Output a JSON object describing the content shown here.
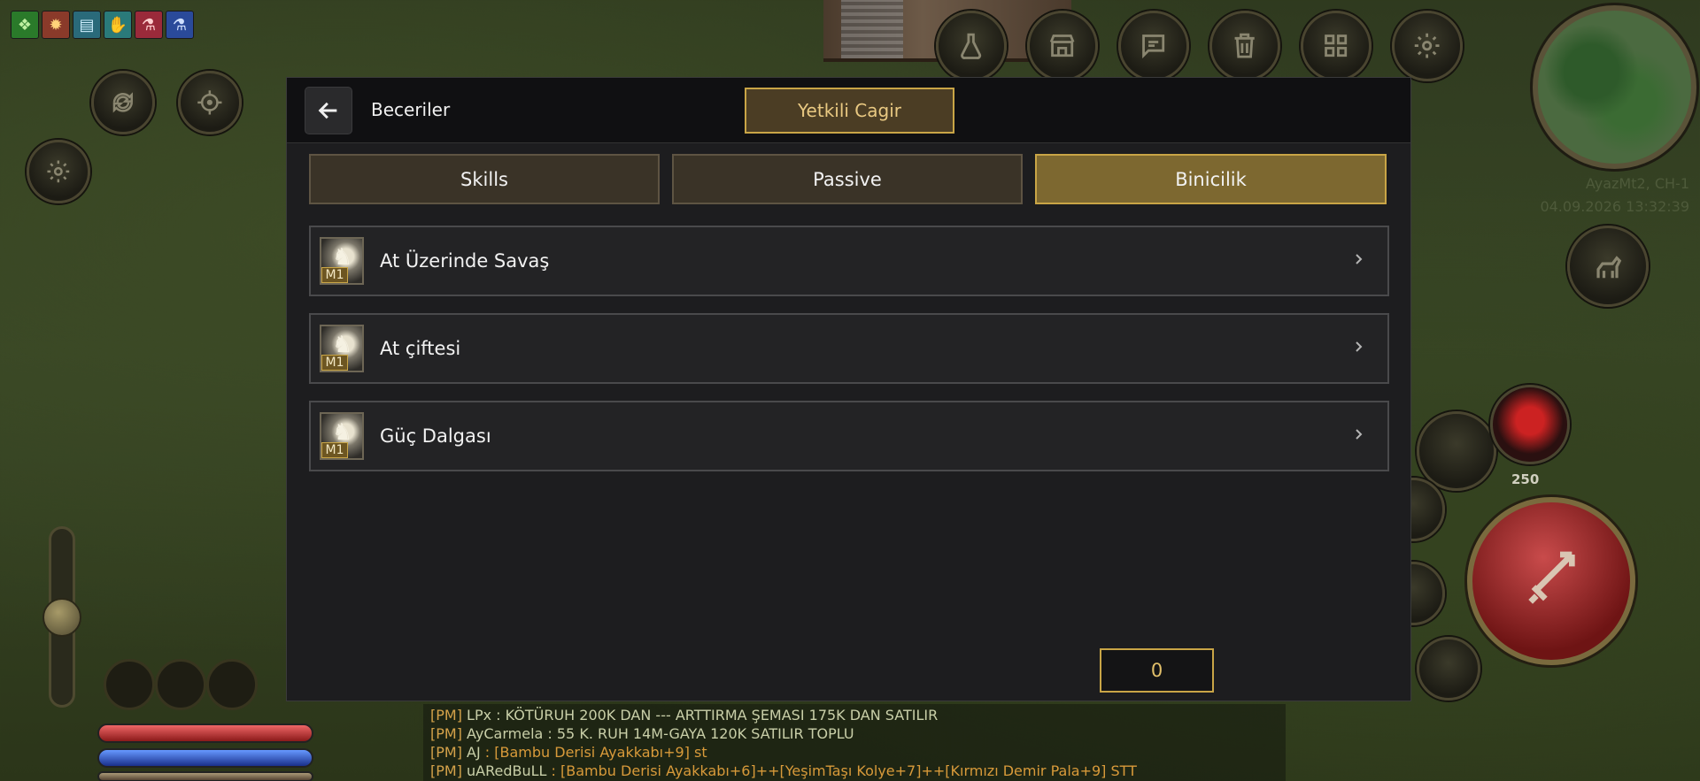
{
  "buffs": [
    {
      "name": "green-dragon-buff-icon",
      "color": "#2a7a2a",
      "glyph": "🐉"
    },
    {
      "name": "sun-buff-icon",
      "color": "#8a3a2a",
      "glyph": "✹"
    },
    {
      "name": "scroll-buff-icon",
      "color": "#2a6a7a",
      "glyph": "▤"
    },
    {
      "name": "hand-buff-icon",
      "color": "#2a7a7a",
      "glyph": "✋"
    },
    {
      "name": "red-potion-buff-icon",
      "color": "#9a2a3a",
      "glyph": "⚗"
    },
    {
      "name": "blue-potion-buff-icon",
      "color": "#2a4a9a",
      "glyph": "⚗"
    }
  ],
  "hud": {
    "server_name": "AyazMt2, CH-1",
    "datetime": "04.09.2026 13:32:39",
    "potion_count": "250"
  },
  "panel": {
    "title": "Beceriler",
    "gm_button_label": "Yetkili Cagir",
    "tabs": [
      {
        "label": "Skills",
        "active": false
      },
      {
        "label": "Passive",
        "active": false
      },
      {
        "label": "Binicilik",
        "active": true
      }
    ],
    "skills": [
      {
        "name": "At Üzerinde Savaş",
        "level": "M1"
      },
      {
        "name": "At çiftesi",
        "level": "M1"
      },
      {
        "name": "Güç Dalgası",
        "level": "M1"
      }
    ],
    "skill_points": "0"
  },
  "chat": [
    {
      "prefix": "[PM]",
      "name": "LPx",
      "text": " : KÖTÜRUH 200K DAN --- ARTTIRMA ŞEMASI 175K DAN SATILIR"
    },
    {
      "prefix": "[PM]",
      "name": "AyCarmela",
      "text": " : 55 K. RUH 14M-GAYA 120K  SATILIR TOPLU"
    },
    {
      "prefix": "[PM]",
      "name": "AJ",
      "text": " : [Bambu Derisi Ayakkabı+9] st"
    },
    {
      "prefix": "[PM]",
      "name": "uARedBuLL",
      "text": " :  [Bambu Derisi Ayakkabı+6]++[YeşimTaşı Kolye+7]++[Kırmızı Demir Pala+9] STT"
    }
  ]
}
